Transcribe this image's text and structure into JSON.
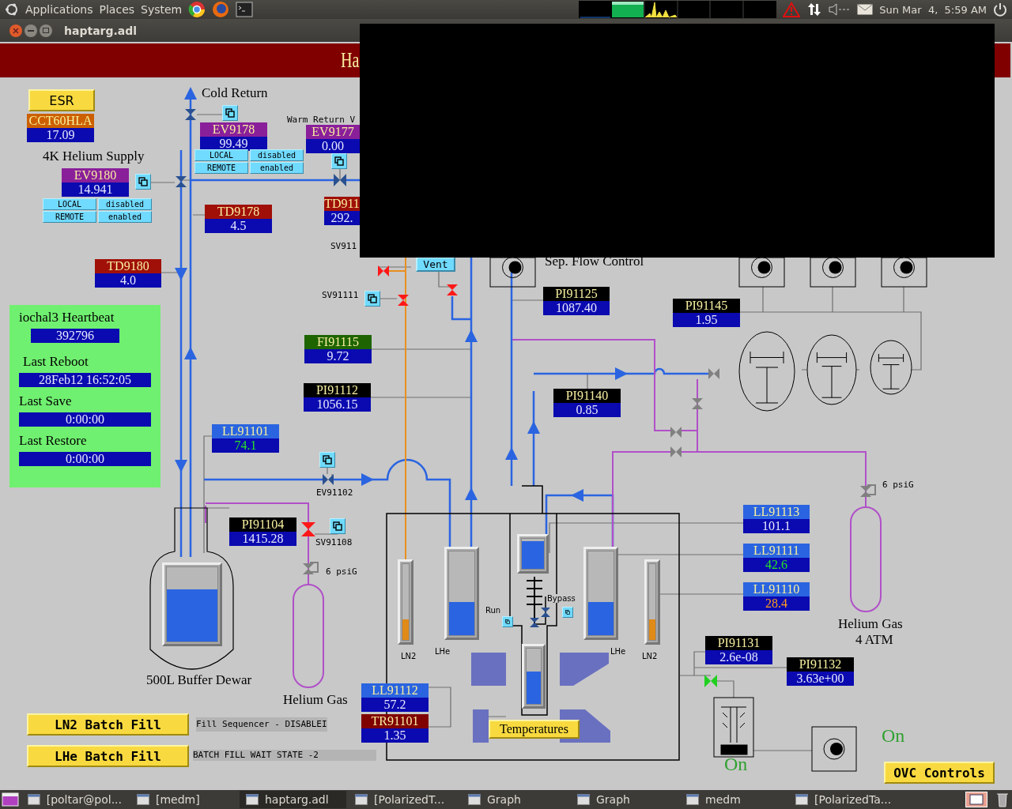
{
  "top_panel": {
    "menus": [
      "Applications",
      "Places",
      "System"
    ],
    "clock": "Sun Mar  4,  5:59 AM"
  },
  "window": {
    "title": "haptarg.adl",
    "banner": "Ha"
  },
  "buttons": [
    "ESR",
    "Vent",
    "Temperatures",
    "LN2 Batch Fill",
    "LHe Batch Fill",
    "OVC Controls"
  ],
  "readouts": [
    {
      "kind": "plain",
      "name": "CCT60HLA",
      "value": "17.09",
      "color": "#cc6000"
    },
    {
      "kind": "plain",
      "name": "EV9178",
      "value": "99.49",
      "color": "#8a1f9a"
    },
    {
      "kind": "plain",
      "name": "EV9177",
      "value": "0.00",
      "color": "#8a1f9a"
    },
    {
      "kind": "plain",
      "name": "EV9180",
      "value": "14.941",
      "color": "#8a1f9a"
    },
    {
      "kind": "plain",
      "name": "TD9178",
      "value": "4.5",
      "color": "#a01008"
    },
    {
      "kind": "plain",
      "name": "TD911",
      "value": "292.",
      "color": "#a01008"
    },
    {
      "kind": "plain",
      "name": "TD9180",
      "value": "4.0",
      "color": "#a01008"
    },
    {
      "kind": "plain",
      "name": "FI91115",
      "value": "9.72",
      "color": "#1e6400"
    },
    {
      "kind": "plain",
      "name": "PI91112",
      "value": "1056.15",
      "color": "#000000"
    },
    {
      "kind": "normal",
      "name": "LL91101",
      "value": "74.1",
      "color": "#2a64e0"
    },
    {
      "kind": "plain",
      "name": "PI91125",
      "value": "1087.40",
      "color": "#000000"
    },
    {
      "kind": "plain",
      "name": "PI91145",
      "value": "1.95",
      "color": "#000000"
    },
    {
      "kind": "plain",
      "name": "PI91140",
      "value": "0.85",
      "color": "#000000"
    },
    {
      "kind": "plain",
      "name": "PI91104",
      "value": "1415.28",
      "color": "#000000"
    },
    {
      "kind": "plain",
      "name": "LL91113",
      "value": "101.1",
      "color": "#2a64e0"
    },
    {
      "kind": "normal",
      "name": "LL91111",
      "value": "42.6",
      "color": "#2a64e0"
    },
    {
      "kind": "minor",
      "name": "LL91110",
      "value": "28.4",
      "color": "#2a64e0"
    },
    {
      "kind": "plain",
      "name": "PI91131",
      "value": "2.6e-08",
      "color": "#000000"
    },
    {
      "kind": "plain",
      "name": "PI91132",
      "value": "3.63e+00",
      "color": "#000000"
    },
    {
      "kind": "plain",
      "name": "LL91112",
      "value": "57.2",
      "color": "#2a64e0"
    },
    {
      "kind": "plain",
      "name": "TR91101",
      "value": "1.35",
      "color": "#800000"
    }
  ],
  "control_groups": [
    {
      "buttons": [
        "LOCAL",
        "disabled",
        "REMOTE",
        "enabled"
      ]
    },
    {
      "buttons": [
        "LOCAL",
        "disabled",
        "REMOTE",
        "enabled"
      ]
    }
  ],
  "labels": [
    "Cold Return",
    "Warm Return V",
    "4K Helium Supply",
    "SV911",
    "SV91111",
    "EV91102",
    "SV91108",
    "6 psiG",
    "Sep. Flow Control",
    "6 psiG",
    "500L Buffer Dewar",
    "Helium Gas",
    "Helium Gas",
    "4 ATM",
    "LN2",
    "LHe",
    "Run",
    "Bypass",
    "LHe",
    "LN2"
  ],
  "heartbeat": {
    "title": "iochal3 Heartbeat",
    "value": "392796",
    "rows": [
      {
        "label": "Last Reboot",
        "value": "28Feb12 16:52:05"
      },
      {
        "label": "Last Save",
        "value": "0:00:00"
      },
      {
        "label": "Last Restore",
        "value": "0:00:00"
      }
    ]
  },
  "status_bars": [
    "Fill Sequencer - DISABLEI",
    "BATCH FILL WAIT STATE -2"
  ],
  "status_texts": [
    "On",
    "On"
  ],
  "tanks": [
    {
      "level": 0.7,
      "color": "#2a64e0"
    },
    {
      "level": 0.27,
      "color": "#e08a18"
    },
    {
      "level": 0.4,
      "color": "#2a64e0"
    },
    {
      "level": 0.92,
      "color": "#2a64e0"
    },
    {
      "level": 0.58,
      "color": "#2a64e0"
    },
    {
      "level": 0.4,
      "color": "#2a64e0"
    },
    {
      "level": 0.27,
      "color": "#e08a18"
    }
  ],
  "taskbar": [
    "[poltar@pol...",
    "[medm]",
    "haptarg.adl",
    "[PolarizedT...",
    "Graph",
    "Graph",
    "medm",
    "[PolarizedTa..."
  ]
}
